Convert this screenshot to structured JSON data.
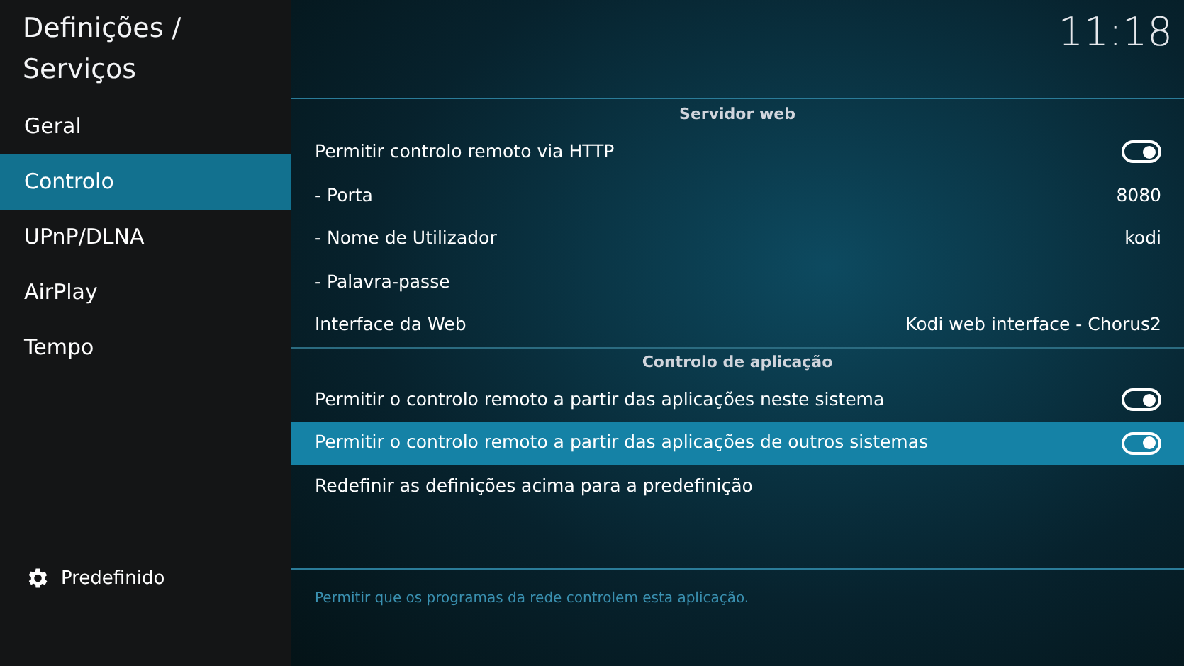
{
  "header": {
    "title": "Definições / Serviços",
    "clock": "11:18"
  },
  "sidebar": {
    "items": [
      {
        "label": "Geral",
        "selected": false
      },
      {
        "label": "Controlo",
        "selected": true
      },
      {
        "label": "UPnP/DLNA",
        "selected": false
      },
      {
        "label": "AirPlay",
        "selected": false
      },
      {
        "label": "Tempo",
        "selected": false
      }
    ],
    "level_button": {
      "label": "Predefinido"
    }
  },
  "settings": [
    {
      "kind": "header",
      "label": "Servidor web"
    },
    {
      "kind": "toggle",
      "label": "Permitir controlo remoto via HTTP",
      "on": true,
      "selected": false
    },
    {
      "kind": "value",
      "label": "- Porta",
      "value": "8080",
      "selected": false
    },
    {
      "kind": "value",
      "label": "- Nome de Utilizador",
      "value": "kodi",
      "selected": false
    },
    {
      "kind": "value",
      "label": "- Palavra-passe",
      "selected": false
    },
    {
      "kind": "value",
      "label": "Interface da Web",
      "value": "Kodi web interface - Chorus2",
      "selected": false
    },
    {
      "kind": "header",
      "label": "Controlo de aplicação"
    },
    {
      "kind": "toggle",
      "label": "Permitir o controlo remoto a partir das aplicações neste sistema",
      "on": true,
      "selected": false
    },
    {
      "kind": "toggle",
      "label": "Permitir o controlo remoto a partir das aplicações de outros sistemas",
      "on": true,
      "selected": true
    },
    {
      "kind": "action",
      "label": "Redefinir as definições acima para a predefinição",
      "selected": false
    }
  ],
  "description": "Permitir que os programas da rede controlem esta aplicação."
}
